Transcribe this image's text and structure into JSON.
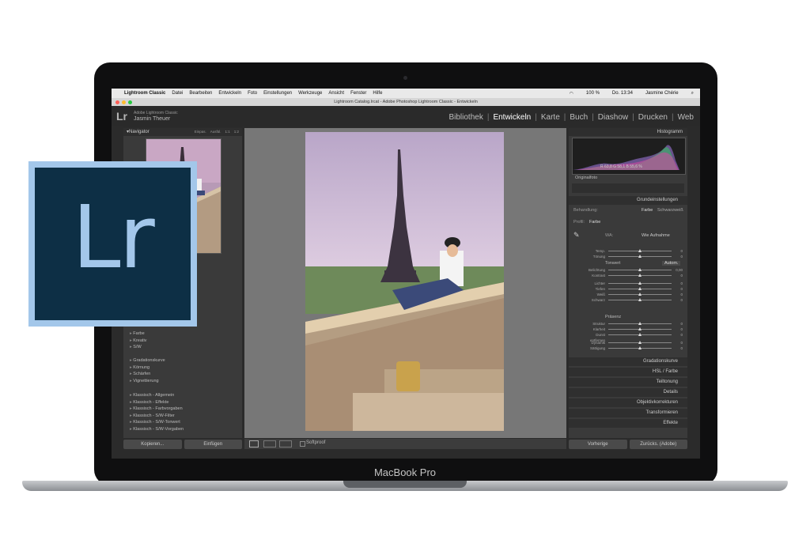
{
  "menubar": {
    "apple": "",
    "app": "Lightroom Classic",
    "items": [
      "Datei",
      "Bearbeiten",
      "Entwickeln",
      "Foto",
      "Einstellungen",
      "Werkzeuge",
      "Ansicht",
      "Fenster",
      "Hilfe"
    ],
    "battery": "100 %",
    "clock": "Do. 13:34",
    "user": "Jasmine Chérie"
  },
  "window_title": "Lightroom Catalog.lrcat - Adobe Photoshop Lightroom Classic - Entwickeln",
  "identity": {
    "logo": "Lr",
    "product": "Adobe Lightroom Classic",
    "user": "Jasmin Theuer"
  },
  "modules": {
    "items": [
      "Bibliothek",
      "Entwickeln",
      "Karte",
      "Buch",
      "Diashow",
      "Drucken",
      "Web"
    ],
    "active": "Entwickeln"
  },
  "left_panel": {
    "navigator_title": "Navigator",
    "nav_options": [
      "Einpas.",
      "Ausfül.",
      "1:1",
      "1:2"
    ],
    "group1": [
      "Farbe",
      "Kreativ",
      "S/W"
    ],
    "group2": [
      "Gradationskurve",
      "Körnung",
      "Schärfen",
      "Vignettierung"
    ],
    "group3": [
      "Klassisch - Allgemein",
      "Klassisch - Effekte",
      "Klassisch - Farbvorgaben",
      "Klassisch - S/W-Filter",
      "Klassisch - S/W-Tonwert",
      "Klassisch - S/W-Vorgaben"
    ],
    "copy_btn": "Kopieren...",
    "paste_btn": "Einfügen"
  },
  "toolbar": {
    "softproof": "Softproof"
  },
  "right_panel": {
    "histogram_title": "Histogramm",
    "hist_values": "R  63,8  G  58,1  B  55,6 %",
    "original_photo": "Originalfoto",
    "basic_title": "Grundeinstellungen",
    "treatment_label": "Behandlung:",
    "treatment_color": "Farbe",
    "treatment_bw": "Schwarzweiß",
    "profile_label": "Profil:",
    "profile_value": "Farbe",
    "wb_label": "WA:",
    "wb_value": "Wie Aufnahme",
    "tone_label": "Tonwert",
    "auto_btn": "Autom.",
    "presence_label": "Präsenz",
    "sliders": [
      {
        "label": "Temp.",
        "value": "0"
      },
      {
        "label": "Tönung",
        "value": "0"
      },
      {
        "label": "Belichtung",
        "value": "0,00"
      },
      {
        "label": "Kontrast",
        "value": "0"
      },
      {
        "label": "Lichter",
        "value": "0"
      },
      {
        "label": "Tiefen",
        "value": "0"
      },
      {
        "label": "Weiß",
        "value": "0"
      },
      {
        "label": "Schwarz",
        "value": "0"
      },
      {
        "label": "Struktur",
        "value": "0"
      },
      {
        "label": "Klarheit",
        "value": "0"
      },
      {
        "label": "Dunst entfernen",
        "value": "0"
      },
      {
        "label": "Dynamik",
        "value": "0"
      },
      {
        "label": "Sättigung",
        "value": "0"
      }
    ],
    "sections": [
      "Gradationskurve",
      "HSL / Farbe",
      "Teiltonung",
      "Details",
      "Objektivkorrekturen",
      "Transformieren",
      "Effekte"
    ],
    "prev_btn": "Vorherige",
    "reset_btn": "Zurücks. (Adobe)"
  },
  "laptop_label": "MacBook Pro",
  "logo_text": "Lr"
}
